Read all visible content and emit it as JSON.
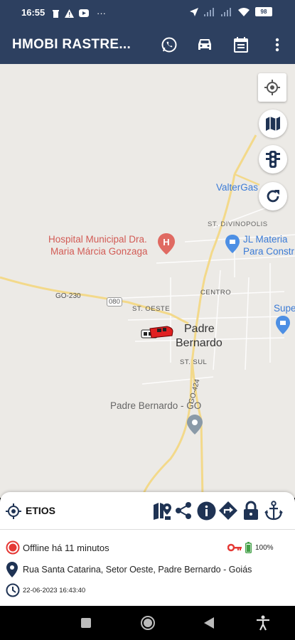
{
  "status_bar": {
    "time": "16:55",
    "dots": "···",
    "battery": "98"
  },
  "app_bar": {
    "title": "HMOBI RASTRE..."
  },
  "map": {
    "labels": {
      "hospital": "Hospital Municipal Dra.",
      "hospital2": "Maria Márcia Gonzaga",
      "valtergas": "ValterGas",
      "divinopolis": "ST. DIVINOPOLIS",
      "jl1": "JL Materia",
      "jl2": "Para Constr",
      "go230": "GO-230",
      "r080": "080",
      "st_oeste": "ST. OESTE",
      "centro": "CENTRO",
      "supe": "Supe",
      "padre1": "Padre",
      "padre2": "Bernardo",
      "st_sul": "ST. SUL",
      "go424": "GO-424",
      "padre_go": "Padre Bernardo - GO"
    }
  },
  "panel": {
    "vehicle_name": "ETIOS",
    "status_text": "Offline há 11 minutos",
    "battery_percent": "100%",
    "address": "Rua Santa Catarina, Setor Oeste, Padre Bernardo - Goiás",
    "datetime": "22-06-2023 16:43:40"
  },
  "colors": {
    "app_bar": "#2d4060",
    "navy": "#1f3354",
    "status_red": "#e53935",
    "key_red": "#e53935",
    "battery_green": "#43a047"
  }
}
